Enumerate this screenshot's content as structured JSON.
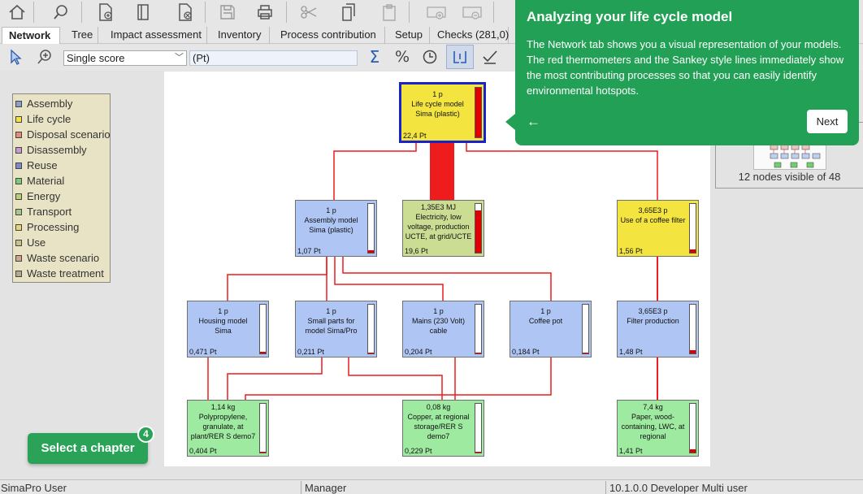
{
  "tabs": [
    {
      "label": "Network",
      "active": true
    },
    {
      "label": "Tree"
    },
    {
      "label": "Impact assessment"
    },
    {
      "label": "Inventory"
    },
    {
      "label": "Process contribution"
    },
    {
      "label": "Setup"
    },
    {
      "label": "Checks (281,0)"
    }
  ],
  "options": {
    "score_mode": "Single score",
    "unit": "(Pt)"
  },
  "legend": [
    {
      "label": "Assembly",
      "color": "#8c9ed0"
    },
    {
      "label": "Life cycle",
      "color": "#f3e24a"
    },
    {
      "label": "Disposal scenario",
      "color": "#e58a7c"
    },
    {
      "label": "Disassembly",
      "color": "#c79bd2"
    },
    {
      "label": "Reuse",
      "color": "#8089c8"
    },
    {
      "label": "Material",
      "color": "#7fc97f"
    },
    {
      "label": "Energy",
      "color": "#b8cf7a"
    },
    {
      "label": "Transport",
      "color": "#a4c88b"
    },
    {
      "label": "Processing",
      "color": "#e2d67c"
    },
    {
      "label": "Use",
      "color": "#c9c08a"
    },
    {
      "label": "Waste scenario",
      "color": "#cfa58e"
    },
    {
      "label": "Waste treatment",
      "color": "#b3aa8f"
    }
  ],
  "nodes": {
    "root": {
      "amount": "1 p",
      "name": "Life cycle model Sima (plastic)",
      "score": "22,4 Pt",
      "fill_fraction": 1.0
    },
    "assembly": {
      "amount": "1 p",
      "name": "Assembly model Sima (plastic)",
      "score": "1,07 Pt",
      "fill_fraction": 0.05
    },
    "electricity": {
      "amount": "1,35E3 MJ",
      "name": "Electricity, low voltage, production UCTE, at grid/UCTE",
      "score": "19,6 Pt",
      "fill_fraction": 0.87
    },
    "filter_use": {
      "amount": "3,65E3 p",
      "name": "Use of a coffee filter",
      "score": "1,56 Pt",
      "fill_fraction": 0.07
    },
    "housing": {
      "amount": "1 p",
      "name": "Housing model Sima",
      "score": "0,471 Pt",
      "fill_fraction": 0.03
    },
    "small_parts": {
      "amount": "1 p",
      "name": "Small parts for model Sima/Pro",
      "score": "0,211 Pt",
      "fill_fraction": 0.01
    },
    "mains": {
      "amount": "1 p",
      "name": "Mains (230 Volt) cable",
      "score": "0,204 Pt",
      "fill_fraction": 0.01
    },
    "coffee_pot": {
      "amount": "1 p",
      "name": "Coffee pot",
      "score": "0,184 Pt",
      "fill_fraction": 0.01
    },
    "filter_prod": {
      "amount": "3,65E3 p",
      "name": "Filter production",
      "score": "1,48 Pt",
      "fill_fraction": 0.07
    },
    "polypropylene": {
      "amount": "1,14 kg",
      "name": "Polypropylene, granulate, at plant/RER S demo7",
      "score": "0,404 Pt",
      "fill_fraction": 0.02
    },
    "copper": {
      "amount": "0,08 kg",
      "name": "Copper, at regional storage/RER S demo7",
      "score": "0,229 Pt",
      "fill_fraction": 0.01
    },
    "paper": {
      "amount": "7,4 kg",
      "name": "Paper, wood-containing, LWC, at regional",
      "score": "1,41 Pt",
      "fill_fraction": 0.06
    }
  },
  "overview": {
    "caption": "12 nodes visible of 48"
  },
  "callout": {
    "title": "Analyzing your life cycle model",
    "body": "The Network tab shows you a visual representation of your models. The red thermometers and the Sankey style lines immediately show the most contributing processes so that you can easily identify environmental hotspots.",
    "back_icon": "←",
    "next_label": "Next"
  },
  "chapter": {
    "label": "Select a chapter",
    "badge": "4"
  },
  "statusbar": {
    "user": "SimaPro User",
    "role": "Manager",
    "version": "10.1.0.0 Developer Multi user"
  }
}
